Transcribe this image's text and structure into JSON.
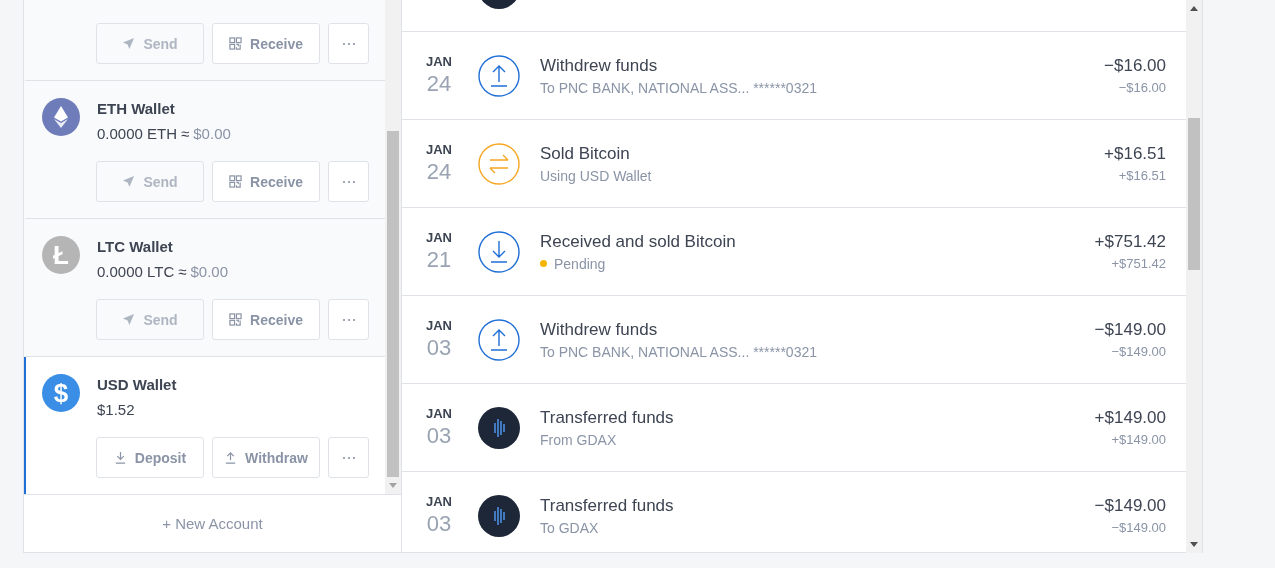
{
  "wallets": [
    {
      "selected": false,
      "buttons": [
        {
          "kind": "send",
          "label": "Send",
          "disabled": true
        },
        {
          "kind": "receive",
          "label": "Receive",
          "disabled": false
        },
        {
          "kind": "more"
        }
      ]
    },
    {
      "name": "ETH Wallet",
      "icon": {
        "kind": "diamond",
        "color": "#6f7cba"
      },
      "balance": "0.0000 ETH",
      "approx": "≈",
      "fiat": "$0.00",
      "selected": false,
      "buttons": [
        {
          "kind": "send",
          "label": "Send",
          "disabled": true
        },
        {
          "kind": "receive",
          "label": "Receive",
          "disabled": false
        },
        {
          "kind": "more"
        }
      ]
    },
    {
      "name": "LTC Wallet",
      "icon": {
        "kind": "glyph",
        "glyph": "Ł",
        "color": "#b5b5b5"
      },
      "balance": "0.0000 LTC",
      "approx": "≈",
      "fiat": "$0.00",
      "selected": false,
      "buttons": [
        {
          "kind": "send",
          "label": "Send",
          "disabled": true
        },
        {
          "kind": "receive",
          "label": "Receive",
          "disabled": false
        },
        {
          "kind": "more"
        }
      ]
    },
    {
      "name": "USD Wallet",
      "icon": {
        "kind": "glyph",
        "glyph": "$",
        "color": "#3a8ee6"
      },
      "balance": "$1.52",
      "selected": true,
      "buttons": [
        {
          "kind": "deposit",
          "label": "Deposit",
          "disabled": false
        },
        {
          "kind": "withdraw",
          "label": "Withdraw",
          "disabled": false
        },
        {
          "kind": "more"
        }
      ]
    }
  ],
  "new_account": "+ New Account",
  "transactions": [
    {
      "kind": "transfer"
    },
    {
      "kind": "withdraw",
      "month": "JAN",
      "day": "24",
      "title": "Withdrew funds",
      "subtitle": "To PNC BANK, NATIONAL ASS... ******0321",
      "pending": false,
      "amount": "−$16.00",
      "fiat": "−$16.00"
    },
    {
      "kind": "sell",
      "month": "JAN",
      "day": "24",
      "title": "Sold Bitcoin",
      "subtitle": "Using USD Wallet",
      "pending": false,
      "amount": "+$16.51",
      "fiat": "+$16.51"
    },
    {
      "kind": "receive",
      "month": "JAN",
      "day": "21",
      "title": "Received and sold Bitcoin",
      "subtitle": "Pending",
      "pending": true,
      "amount": "+$751.42",
      "fiat": "+$751.42"
    },
    {
      "kind": "withdraw",
      "month": "JAN",
      "day": "03",
      "title": "Withdrew funds",
      "subtitle": "To PNC BANK, NATIONAL ASS... ******0321",
      "pending": false,
      "amount": "−$149.00",
      "fiat": "−$149.00"
    },
    {
      "kind": "transfer",
      "month": "JAN",
      "day": "03",
      "title": "Transferred funds",
      "subtitle": "From GDAX",
      "pending": false,
      "amount": "+$149.00",
      "fiat": "+$149.00"
    },
    {
      "kind": "transfer",
      "month": "JAN",
      "day": "03",
      "title": "Transferred funds",
      "subtitle": "To GDAX",
      "pending": false,
      "amount": "−$149.00",
      "fiat": "−$149.00"
    }
  ]
}
